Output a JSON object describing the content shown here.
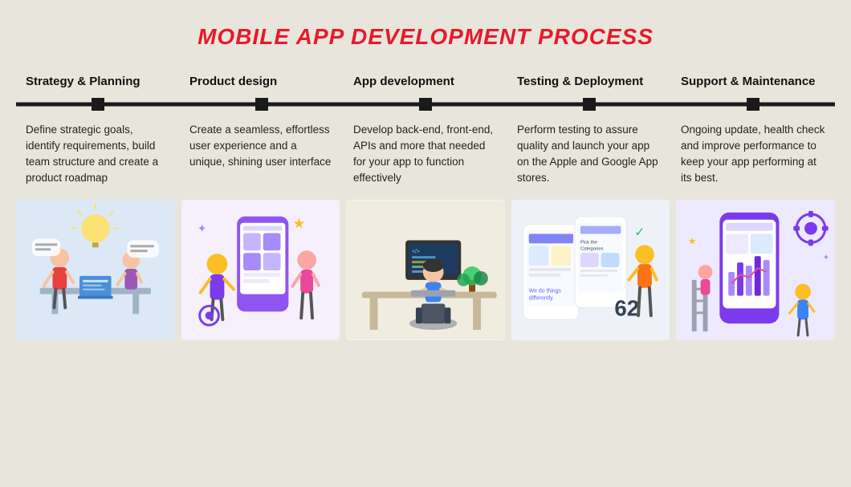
{
  "title": "MOBILE APP DEVELOPMENT PROCESS",
  "phases": [
    {
      "id": "strategy",
      "header": "Strategy & Planning",
      "description": "Define strategic goals, identify requirements, build team structure and create a product roadmap",
      "image_theme": "strategy",
      "image_bg": "#dce8f5",
      "marker_pos": "10%"
    },
    {
      "id": "product",
      "header": "Product design",
      "description": "Create a seamless, effortless user experience and a unique, shining user interface",
      "image_theme": "product",
      "image_bg": "#f5f0fc",
      "marker_pos": "30%"
    },
    {
      "id": "appdev",
      "header": "App development",
      "description": "Develop back-end, front-end, APIs and more that needed for your app to function effectively",
      "image_theme": "appdev",
      "image_bg": "#f5f5ee",
      "marker_pos": "50%"
    },
    {
      "id": "testing",
      "header": "Testing & Deployment",
      "description": "Perform testing to assure quality and launch your app on the Apple and Google App stores.",
      "image_theme": "testing",
      "image_bg": "#f0f4fa",
      "marker_pos": "70%"
    },
    {
      "id": "support",
      "header": "Support & Maintenance",
      "description": "Ongoing update, health check and improve performance to keep your app performing at its best.",
      "image_theme": "support",
      "image_bg": "#f0eefa",
      "marker_pos": "90%"
    }
  ]
}
